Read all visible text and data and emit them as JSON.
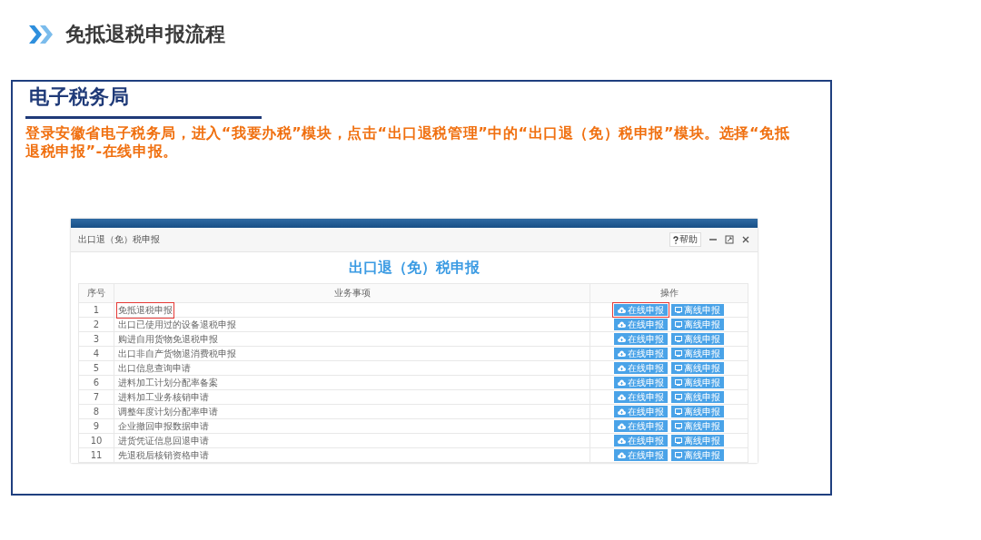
{
  "slide_title": "免抵退税申报流程",
  "panel": {
    "heading": "电子税务局",
    "instruction": "登录安徽省电子税务局，进入“我要办税”模块，点击“出口退税管理”中的“出口退（免）税申报”模块。选择“免抵退税申报”-在线申报。"
  },
  "app": {
    "window_title": "出口退（免）税申报",
    "help_button": "帮助",
    "page_heading": "出口退（免）税申报",
    "table": {
      "columns": [
        "序号",
        "业务事项",
        "操作"
      ],
      "rows": [
        {
          "no": "1",
          "item": "免抵退税申报",
          "online_button": "在线申报",
          "offline_button": "离线申报",
          "highlighted": true
        },
        {
          "no": "2",
          "item": "出口已使用过的设备退税申报",
          "online_button": "在线申报",
          "offline_button": "离线申报",
          "highlighted": false
        },
        {
          "no": "3",
          "item": "购进自用货物免退税申报",
          "online_button": "在线申报",
          "offline_button": "离线申报",
          "highlighted": false
        },
        {
          "no": "4",
          "item": "出口非自产货物退消费税申报",
          "online_button": "在线申报",
          "offline_button": "离线申报",
          "highlighted": false
        },
        {
          "no": "5",
          "item": "出口信息查询申请",
          "online_button": "在线申报",
          "offline_button": "离线申报",
          "highlighted": false
        },
        {
          "no": "6",
          "item": "进料加工计划分配率备案",
          "online_button": "在线申报",
          "offline_button": "离线申报",
          "highlighted": false
        },
        {
          "no": "7",
          "item": "进料加工业务核销申请",
          "online_button": "在线申报",
          "offline_button": "离线申报",
          "highlighted": false
        },
        {
          "no": "8",
          "item": "调整年度计划分配率申请",
          "online_button": "在线申报",
          "offline_button": "离线申报",
          "highlighted": false
        },
        {
          "no": "9",
          "item": "企业撤回申报数据申请",
          "online_button": "在线申报",
          "offline_button": "离线申报",
          "highlighted": false
        },
        {
          "no": "10",
          "item": "进货凭证信息回退申请",
          "online_button": "在线申报",
          "offline_button": "离线申报",
          "highlighted": false
        },
        {
          "no": "11",
          "item": "先退税后核销资格申请",
          "online_button": "在线申报",
          "offline_button": "离线申报",
          "highlighted": false
        }
      ]
    }
  }
}
